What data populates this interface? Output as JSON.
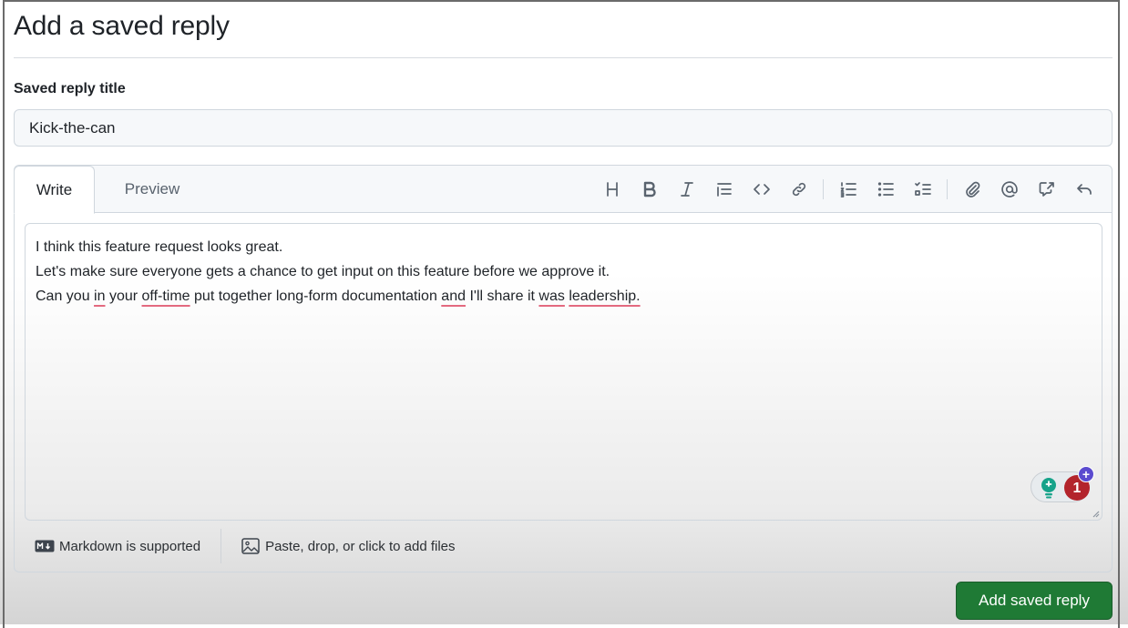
{
  "page": {
    "title": "Add a saved reply"
  },
  "form": {
    "title_label": "Saved reply title",
    "title_value": "Kick-the-can",
    "submit_label": "Add saved reply"
  },
  "editor": {
    "tabs": [
      {
        "label": "Write",
        "active": true
      },
      {
        "label": "Preview",
        "active": false
      }
    ],
    "toolbar": [
      {
        "icon": "heading-icon"
      },
      {
        "icon": "bold-icon"
      },
      {
        "icon": "italic-icon"
      },
      {
        "icon": "quote-icon"
      },
      {
        "icon": "code-icon"
      },
      {
        "icon": "link-icon"
      },
      {
        "icon": "ordered-list-icon"
      },
      {
        "icon": "unordered-list-icon"
      },
      {
        "icon": "task-list-icon"
      },
      {
        "icon": "attach-icon"
      },
      {
        "icon": "mention-icon"
      },
      {
        "icon": "cross-reference-icon"
      },
      {
        "icon": "saved-replies-icon"
      }
    ],
    "body": {
      "line1": "I think this feature request looks great.",
      "line2": "Let's make sure everyone gets a chance to get input on this feature before we approve it.",
      "line3": {
        "p1": "Can you ",
        "w1": "in",
        "p2": " your ",
        "w2": "off-time",
        "p3": " put together long-form documentation ",
        "w3": "and",
        "p4": " I'll share it ",
        "w4": "was",
        "p5": " ",
        "w5": "leadership."
      }
    },
    "grammar_extension": {
      "count": "1",
      "plus": "+"
    },
    "footer": {
      "markdown_note": "Markdown is supported",
      "files_note": "Paste, drop, or click to add files"
    }
  },
  "colors": {
    "submit_green": "#1f7a35",
    "badge_red": "#b3242c",
    "badge_purple": "#5b4bcf",
    "squiggle_pink": "#e3697f"
  }
}
